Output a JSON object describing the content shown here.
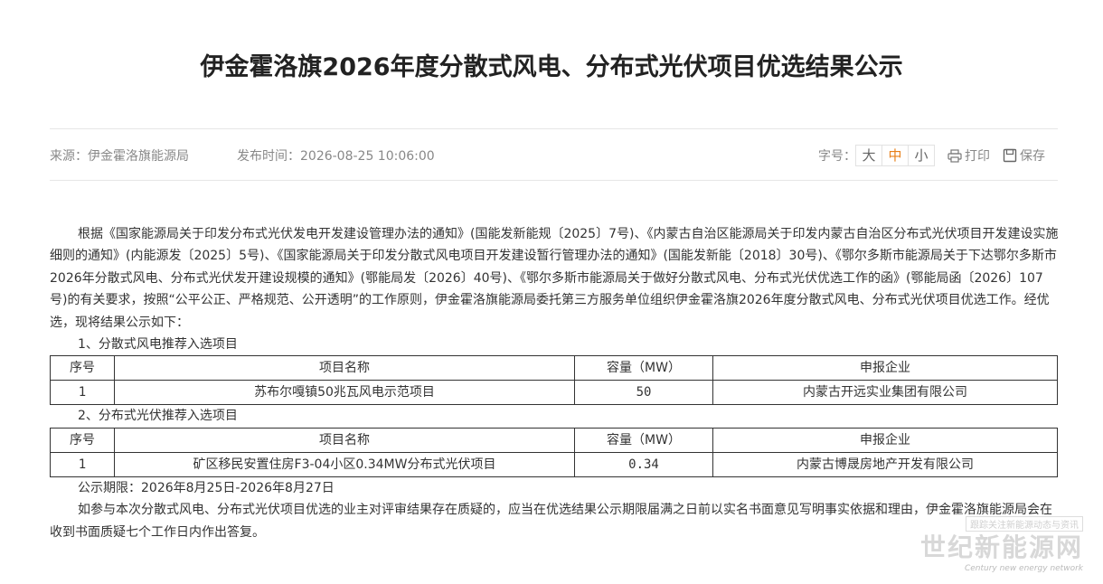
{
  "title": "伊金霍洛旗2026年度分散式风电、分布式光伏项目优选结果公示",
  "meta": {
    "source": "来源：伊金霍洛旗能源局",
    "time": "发布时间：2026-08-25 10:06:00",
    "fontsize_label": "字号：",
    "font_large": "大",
    "font_medium": "中",
    "font_small": "小",
    "print": "打印",
    "save": "保存",
    "active_color": "#e8801a"
  },
  "body": {
    "intro": "根据《国家能源局关于印发分布式光伏发电开发建设管理办法的通知》(国能发新能规〔2025〕7号)、《内蒙古自治区能源局关于印发内蒙古自治区分布式光伏项目开发建设实施细则的通知》(内能源发〔2025〕5号)、《国家能源局关于印发分散式风电项目开发建设暂行管理办法的通知》(国能发新能〔2018〕30号)、《鄂尔多斯市能源局关于下达鄂尔多斯市2026年分散式风电、分布式光伏发开建设规模的通知》(鄂能局发〔2026〕40号)、《鄂尔多斯市能源局关于做好分散式风电、分布式光伏优选工作的函》(鄂能局函〔2026〕107号)的有关要求，按照“公平公正、严格规范、公开透明”的工作原则，伊金霍洛旗能源局委托第三方服务单位组织伊金霍洛旗2026年度分散式风电、分布式光伏项目优选工作。经优选，现将结果公示如下：",
    "section1": "1、分散式风电推荐入选项目",
    "section2": "2、分布式光伏推荐入选项目",
    "headers": [
      "序号",
      "项目名称",
      "容量（MW）",
      "申报企业"
    ],
    "table1": [
      {
        "no": "1",
        "name": "苏布尔嘎镇50兆瓦风电示范项目",
        "capacity": "50",
        "company": "内蒙古开远实业集团有限公司"
      }
    ],
    "table2": [
      {
        "no": "1",
        "name": "矿区移民安置住房F3-04小区0.34MW分布式光伏项目",
        "capacity": "0.34",
        "company": "内蒙古博晟房地产开发有限公司"
      }
    ],
    "period": "公示期限：2026年8月25日-2026年8月27日",
    "closing": "如参与本次分散式风电、分布式光伏项目优选的业主对评审结果存在质疑的，应当在优选结果公示期限届满之日前以实名书面意见写明事实依据和理由，伊金霍洛旗能源局会在收到书面质疑七个工作日内作出答复。"
  },
  "watermark": {
    "top": "跟踪关注新能源动态与资讯",
    "big": "世纪新能源网",
    "en": "Century new energy network"
  }
}
